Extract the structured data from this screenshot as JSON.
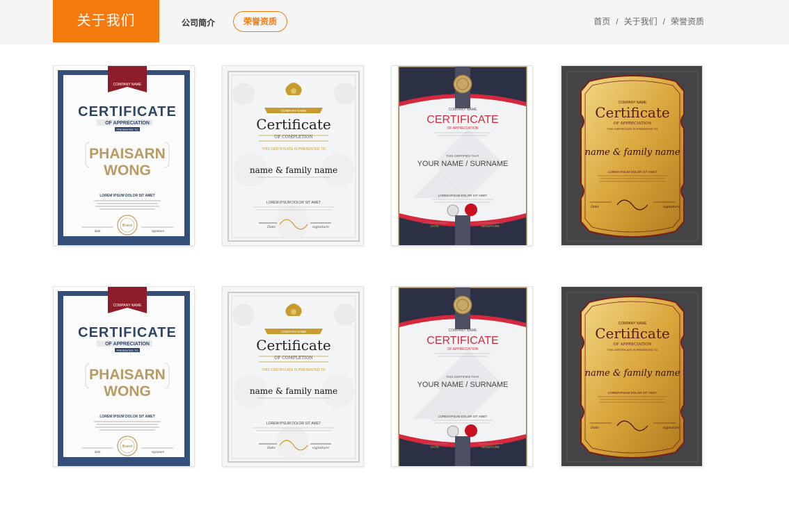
{
  "header": {
    "section_title": "关于我们",
    "subnav": [
      {
        "label": "公司简介"
      },
      {
        "label": "荣誉资质"
      }
    ],
    "active_tab": "荣誉资质",
    "breadcrumb": [
      "首页",
      "关于我们",
      "荣誉资质"
    ],
    "accent_color": "#f47a0e"
  },
  "certificates": [
    {
      "style": "navy-appreciation",
      "ribbon": "COMPANY NAME",
      "title": "CERTIFICATE",
      "subtitle": "OF APPRECIATION",
      "presented": "PRESENTED TO",
      "name_line1": "PHAISARN",
      "name_line2": "WONG",
      "lorem": "LOREM IPSUM DOLOR SIT AMET",
      "seal": "Brand",
      "left_sig": "date",
      "right_sig": "signature"
    },
    {
      "style": "white-completion",
      "ribbon": "COMPANY NAME",
      "title": "Certificate",
      "subtitle": "OF COMPLETION",
      "presented": "THIS CERTIFICATE IS PRESENTED TO",
      "name": "name & family name",
      "lorem": "LOREM IPSUM DOLOR SIT AMET",
      "left_sig": "Date",
      "right_sig": "signature"
    },
    {
      "style": "dark-red-modern",
      "company": "COMPANY NAME",
      "title": "CERTIFICATE",
      "subtitle": "OF APPRECIATION",
      "presented": "THIS CERTIFIES THAT",
      "name": "YOUR NAME / SURNAME",
      "lorem": "LOREM IPSUM DOLOR SIT AMET",
      "left_sig": "DATE",
      "right_sig": "SIGNATURE"
    },
    {
      "style": "gold-ornate",
      "company": "COMPANY NAME",
      "title": "Certificate",
      "subtitle": "OF APPRECIATION",
      "presented": "THIS CERTIFICATE IS PRESENTED TO",
      "name": "name & family name",
      "lorem": "LOREM IPSUM DOLOR SIT AMET",
      "left_sig": "Date",
      "right_sig": "signature"
    },
    {
      "style": "navy-appreciation",
      "ribbon": "COMPANY NAME",
      "title": "CERTIFICATE",
      "subtitle": "OF APPRECIATION",
      "presented": "PRESENTED TO",
      "name_line1": "PHAISARN",
      "name_line2": "WONG",
      "lorem": "LOREM IPSUM DOLOR SIT AMET",
      "seal": "Brand",
      "left_sig": "date",
      "right_sig": "signature"
    },
    {
      "style": "white-completion",
      "ribbon": "COMPANY NAME",
      "title": "Certificate",
      "subtitle": "OF COMPLETION",
      "presented": "THIS CERTIFICATE IS PRESENTED TO",
      "name": "name & family name",
      "lorem": "LOREM IPSUM DOLOR SIT AMET",
      "left_sig": "Date",
      "right_sig": "signature"
    },
    {
      "style": "dark-red-modern",
      "company": "COMPANY NAME",
      "title": "CERTIFICATE",
      "subtitle": "OF APPRECIATION",
      "presented": "THIS CERTIFIES THAT",
      "name": "YOUR NAME / SURNAME",
      "lorem": "LOREM IPSUM DOLOR SIT AMET",
      "left_sig": "DATE",
      "right_sig": "SIGNATURE"
    },
    {
      "style": "gold-ornate",
      "company": "COMPANY NAME",
      "title": "Certificate",
      "subtitle": "OF APPRECIATION",
      "presented": "THIS CERTIFICATE IS PRESENTED TO",
      "name": "name & family name",
      "lorem": "LOREM IPSUM DOLOR SIT AMET",
      "left_sig": "Date",
      "right_sig": "signature"
    }
  ]
}
